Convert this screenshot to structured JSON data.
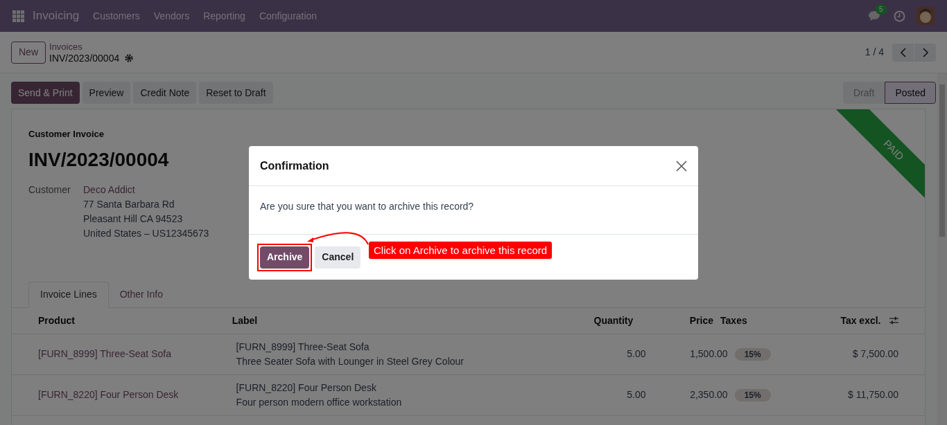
{
  "navbar": {
    "app": "Invoicing",
    "menus": [
      "Customers",
      "Vendors",
      "Reporting",
      "Configuration"
    ],
    "message_count": "5"
  },
  "breadcrumb": {
    "new_button": "New",
    "parent": "Invoices",
    "current": "INV/2023/00004"
  },
  "pager": {
    "text": "1 / 4"
  },
  "actions": [
    {
      "label": "Send & Print",
      "primary": true
    },
    {
      "label": "Preview",
      "primary": false
    },
    {
      "label": "Credit Note",
      "primary": false
    },
    {
      "label": "Reset to Draft",
      "primary": false
    }
  ],
  "statuses": [
    {
      "label": "Draft",
      "selected": false
    },
    {
      "label": "Posted",
      "selected": true
    }
  ],
  "invoice": {
    "type": "Customer Invoice",
    "number": "INV/2023/00004",
    "ribbon": "PAID",
    "customer_label": "Customer",
    "customer": "Deco Addict",
    "address": [
      "77 Santa Barbara Rd",
      "Pleasant Hill CA 94523",
      "United States – US12345673"
    ]
  },
  "tabs": [
    {
      "label": "Invoice Lines",
      "selected": true
    },
    {
      "label": "Other Info",
      "selected": false
    }
  ],
  "table": {
    "columns": [
      "Product",
      "Label",
      "Quantity",
      "Price",
      "Taxes",
      "Tax excl."
    ],
    "rows": [
      {
        "product": "[FURN_8999] Three-Seat Sofa",
        "label": [
          "[FURN_8999] Three-Seat Sofa",
          "Three Seater Sofa with Lounger in Steel Grey Colour"
        ],
        "quantity": "5.00",
        "price": "1,500.00",
        "taxes": "15%",
        "tax_excl": "$ 7,500.00"
      },
      {
        "product": "[FURN_8220] Four Person Desk",
        "label": [
          "[FURN_8220] Four Person Desk",
          "Four person modern office workstation"
        ],
        "quantity": "5.00",
        "price": "2,350.00",
        "taxes": "15%",
        "tax_excl": "$ 11,750.00"
      }
    ]
  },
  "dialog": {
    "title": "Confirmation",
    "message": "Are you sure that you want to archive this record?",
    "buttons": [
      {
        "label": "Archive",
        "primary": true,
        "highlighted": true
      },
      {
        "label": "Cancel",
        "primary": false,
        "highlighted": false
      }
    ],
    "callout": "Click on Archive to archive this record"
  }
}
